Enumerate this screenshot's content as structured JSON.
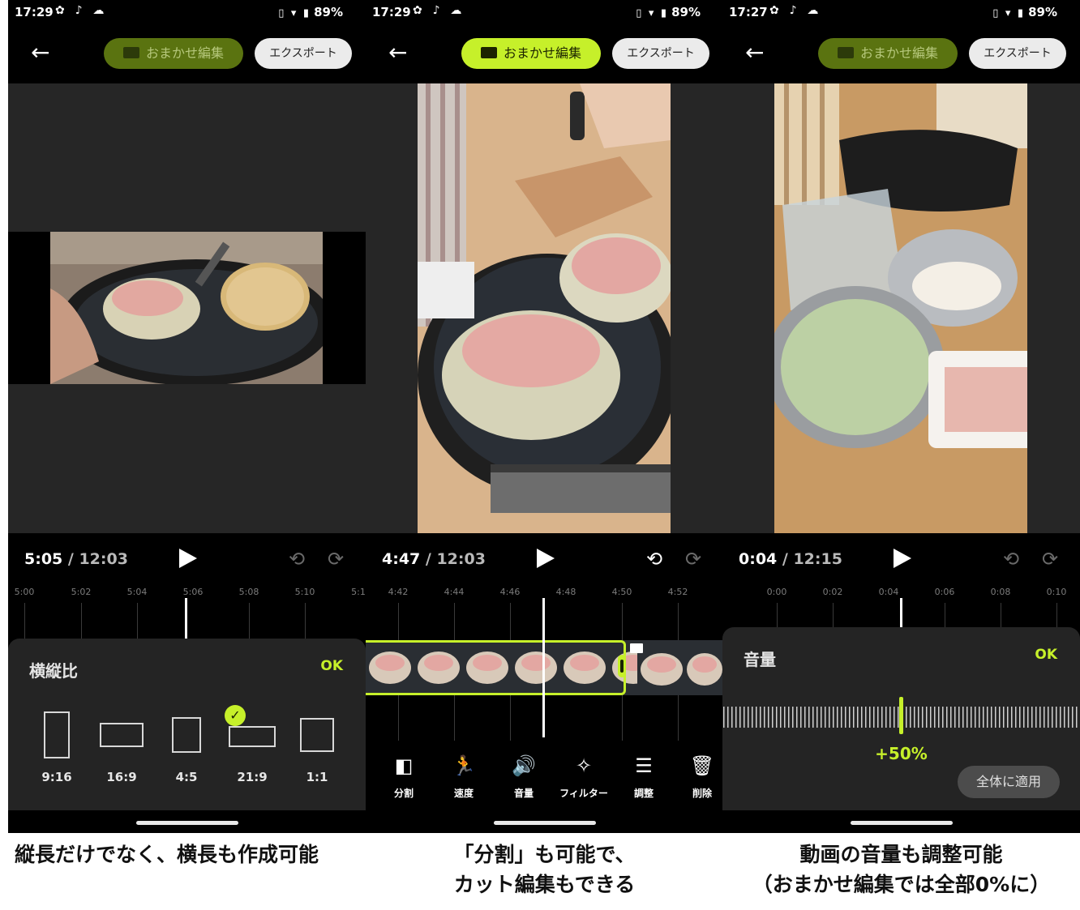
{
  "common": {
    "auto_edit_label": "おまかせ編集",
    "export_label": "エクスポート",
    "status_icons": "✿ ♪ ☁",
    "status_right_symbols": "▯ ▾ ▮",
    "battery": "89%"
  },
  "colors": {
    "accent": "#c6f02a",
    "accent_dim": "#5a7310",
    "sheet": "#242424",
    "preview_bg": "#262626"
  },
  "screens": [
    {
      "time": "17:29",
      "current": "5:05",
      "duration": "/ 12:03",
      "ticks": [
        "5:00",
        "5:02",
        "5:04",
        "5:06",
        "5:08",
        "5:10",
        "5:1"
      ],
      "sheet": {
        "title": "横縦比",
        "ok": "OK",
        "ratios": [
          "9:16",
          "16:9",
          "4:5",
          "21:9",
          "1:1"
        ],
        "selected": "21:9"
      }
    },
    {
      "time": "17:29",
      "current": "4:47",
      "duration": "/ 12:03",
      "ticks": [
        "4:42",
        "4:44",
        "4:46",
        "4:48",
        "4:50",
        "4:52"
      ],
      "tools": [
        "分割",
        "速度",
        "音量",
        "フィルター",
        "調整",
        "削除"
      ]
    },
    {
      "time": "17:27",
      "current": "0:04",
      "duration": "/ 12:15",
      "ticks": [
        "0:00",
        "0:02",
        "0:04",
        "0:06",
        "0:08",
        "0:10"
      ],
      "sheet": {
        "title": "音量",
        "ok": "OK",
        "value": "+50%",
        "apply": "全体に適用"
      }
    }
  ],
  "captions": {
    "first": "縦長だけでなく、横長も作成可能",
    "second_line1": "「分割」も可能で、",
    "second_line2": "カット編集もできる",
    "third_line1": "動画の音量も調整可能",
    "third_line2": "（おまかせ編集では全部0%に）"
  }
}
